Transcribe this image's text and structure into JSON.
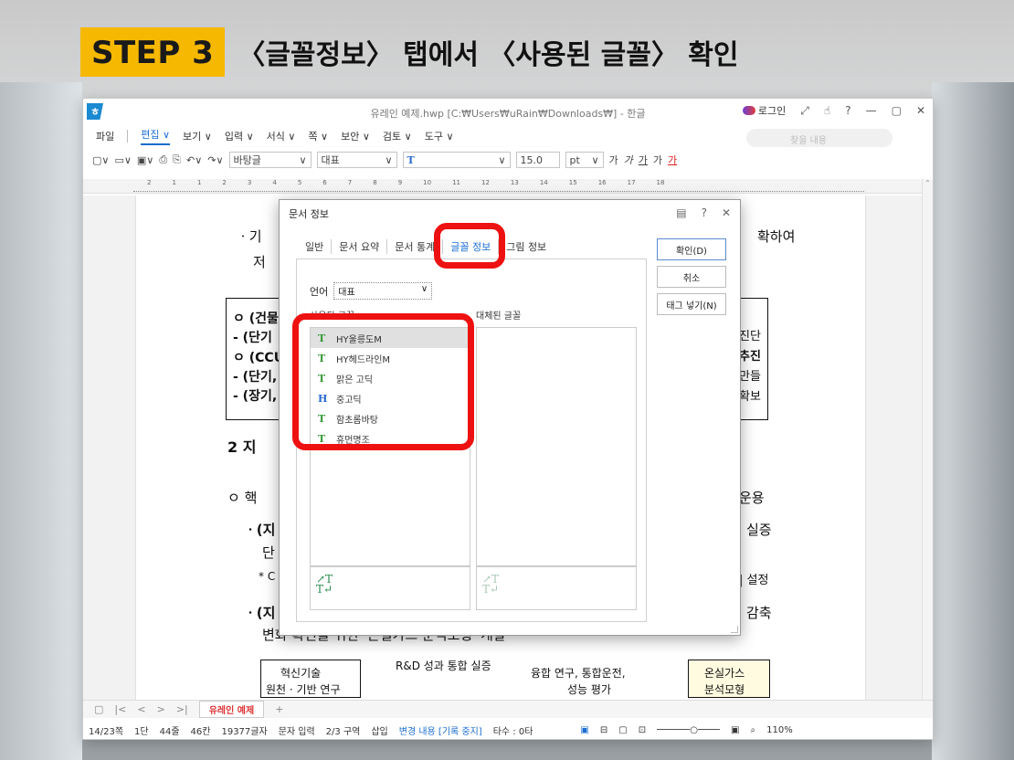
{
  "headline": {
    "step": "STEP 3",
    "text": "〈글꼴정보〉 탭에서 〈사용된 글꼴〉 확인"
  },
  "window": {
    "title": "유레인 예제.hwp [C:₩Users₩uRain₩Downloads₩] - 한글",
    "logo": "ㅎ",
    "login": "로그인",
    "controls": [
      "⤢",
      "☝",
      "?",
      "—",
      "▢",
      "✕"
    ]
  },
  "menu": {
    "items": [
      "파일",
      "편집 ∨",
      "보기 ∨",
      "입력 ∨",
      "서식 ∨",
      "쪽 ∨",
      "보안 ∨",
      "검토 ∨",
      "도구 ∨"
    ],
    "active_index": 1,
    "search_placeholder": "찾을 내용"
  },
  "toolbar": {
    "style": "바탕글",
    "lang": "대표",
    "font": "T",
    "size": "15.0",
    "unit": "pt",
    "format": [
      "가",
      "가",
      "가",
      "가",
      "가"
    ]
  },
  "ruler": {
    "ticks": [
      "2",
      "1",
      "1",
      "2",
      "3",
      "4",
      "5",
      "6",
      "7",
      "8",
      "9",
      "10",
      "11",
      "12",
      "13",
      "14",
      "15",
      "16",
      "17",
      "18"
    ]
  },
  "document": {
    "lines": [
      "ㆍ기",
      "저",
      "ㅇ (건물",
      "- (단기",
      "ㅇ (CCU",
      "- (단기,",
      "- (장기,",
      "2  지",
      "ㅇ 핵",
      "ㆍ(지",
      "단",
      "* C",
      "ㆍ(지",
      "변화 확인을 위한 '온실가스 분석모형' 개발",
      "확하여",
      "진단",
      "추진",
      "만들",
      "확보",
      "운용",
      "실증",
      "| 설정",
      "감축",
      "혁신기술",
      "원천 · 기반 연구",
      "R&D 성과 통합 실증",
      "융합 연구, 통합운전,",
      "성능 평가",
      "온실가스",
      "분석모형"
    ]
  },
  "tabbar": {
    "doc_tab": "유레인 예제",
    "add": "+"
  },
  "status": {
    "page": "14/23쪽",
    "dan": "1단",
    "line": "44줄",
    "col": "46칸",
    "chars": "19377글자",
    "mode": "문자 입력",
    "section": "2/3 구역",
    "insert": "삽입",
    "track": "변경 내용 [기록 중지]",
    "tasu": "타수 : 0타",
    "zoom": "110%"
  },
  "dialog": {
    "title": "문서 정보",
    "tabs": [
      "일반",
      "문서 요약",
      "문서 통계",
      "글꼴 정보",
      "그림 정보"
    ],
    "active_tab": 3,
    "lang_label": "언어",
    "lang_value": "대표",
    "used_label": "사용된 글꼴",
    "replaced_label": "대체된 글꼴",
    "fonts": [
      {
        "name": "HY울릉도M",
        "icon": "T",
        "type": "t"
      },
      {
        "name": "HY헤드라인M",
        "icon": "T",
        "type": "t"
      },
      {
        "name": "맑은 고딕",
        "icon": "T",
        "type": "t"
      },
      {
        "name": "중고딕",
        "icon": "H",
        "type": "h"
      },
      {
        "name": "함초롬바탕",
        "icon": "T",
        "type": "t"
      },
      {
        "name": "휴먼명조",
        "icon": "T",
        "type": "t"
      }
    ],
    "buttons": {
      "ok": "확인(D)",
      "cancel": "취소",
      "tag": "태그 넣기(N)"
    },
    "accent": "#1a6dd1",
    "highlight": "#e11"
  }
}
